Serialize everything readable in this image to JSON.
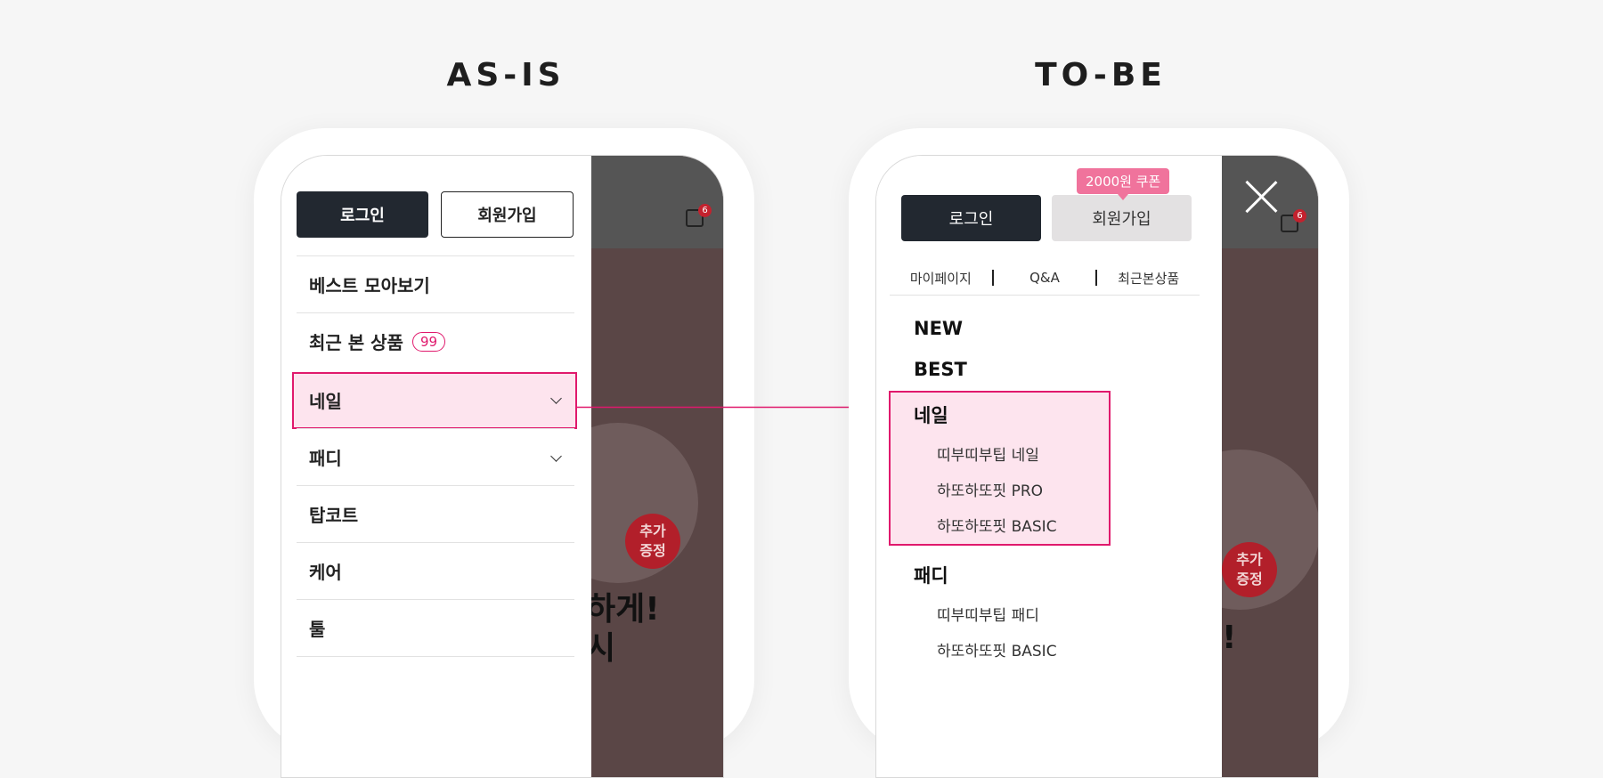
{
  "headings": {
    "as_is": "AS-IS",
    "to_be": "TO-BE"
  },
  "as_is": {
    "login_label": "로그인",
    "signup_label": "회원가입",
    "cart_count": "6",
    "menu": [
      {
        "label": "베스트 모아보기"
      },
      {
        "label": "최근 본 상품",
        "badge": "99"
      },
      {
        "label": "네일"
      },
      {
        "label": "패디"
      },
      {
        "label": "탑코트"
      },
      {
        "label": "케어"
      },
      {
        "label": "툴"
      }
    ],
    "background": {
      "badge": "추가\n증정",
      "text_line1": "하게!",
      "text_line2": "시"
    }
  },
  "to_be": {
    "coupon_label": "2000원 쿠폰",
    "login_label": "로그인",
    "signup_label": "회원가입",
    "cart_count": "6",
    "sublinks": [
      "마이페이지",
      "Q&A",
      "최근본상품"
    ],
    "categories": [
      {
        "label": "NEW"
      },
      {
        "label": "BEST"
      },
      {
        "label": "네일",
        "items": [
          "띠부띠부팁 네일",
          "하또하또핏 PRO",
          "하또하또핏 BASIC"
        ]
      },
      {
        "label": "패디",
        "items": [
          "띠부띠부팁 패디",
          "하또하또핏 BASIC"
        ]
      }
    ],
    "background": {
      "badge": "추가\n증정",
      "text": "!"
    }
  },
  "colors": {
    "accent": "#e0196c",
    "highlight_bg": "#fde4ee",
    "dark_button": "#222830",
    "coupon": "#f0739c"
  }
}
